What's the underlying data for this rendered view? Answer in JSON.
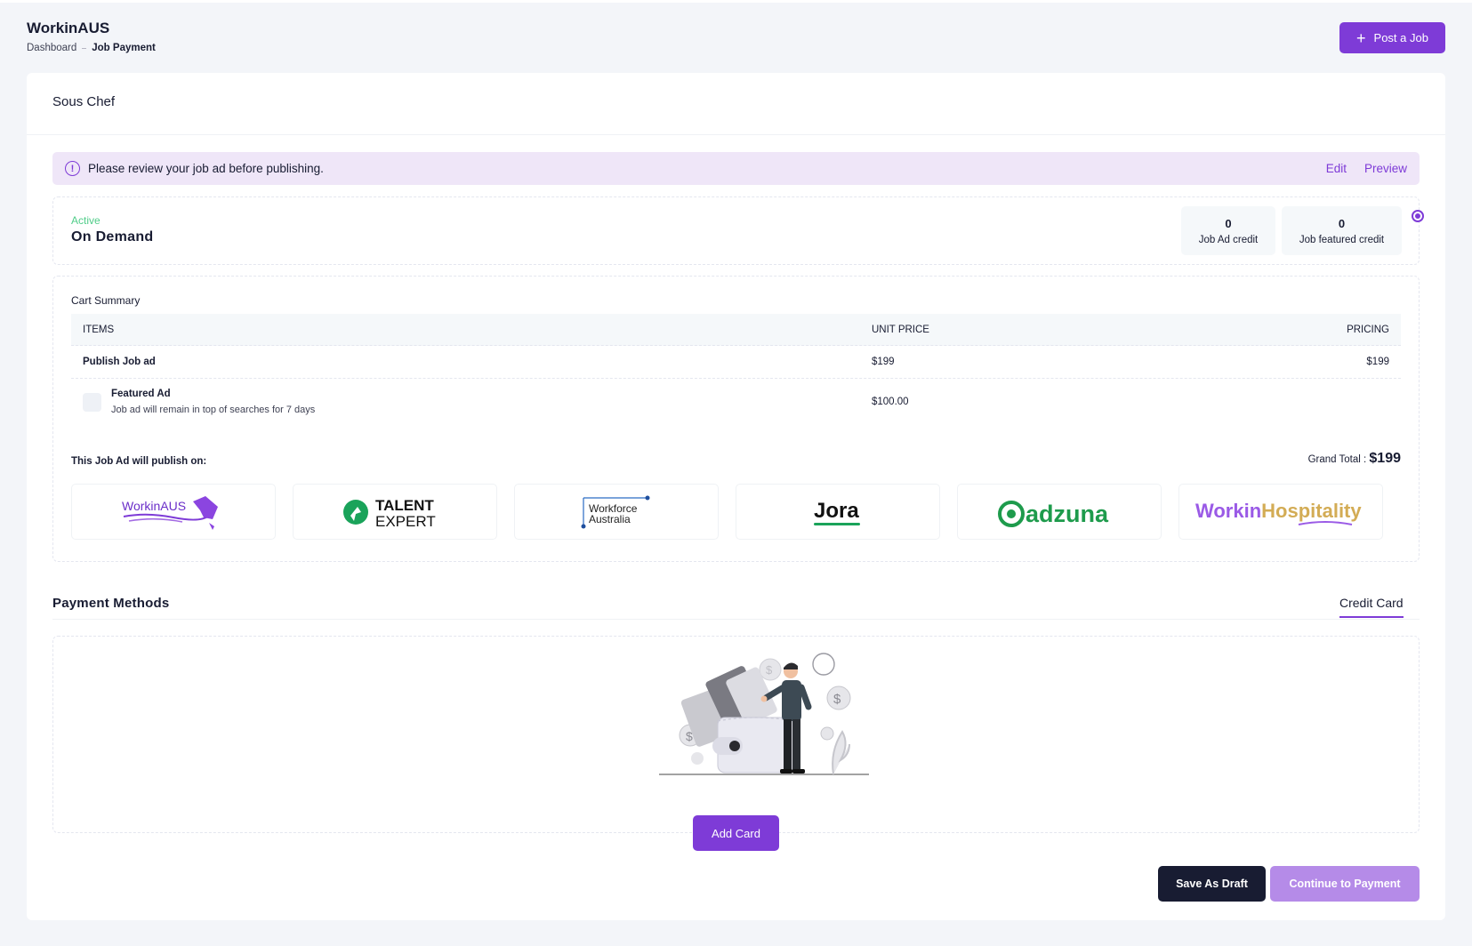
{
  "app": {
    "title": "WorkinAUS"
  },
  "breadcrumb": {
    "root": "Dashboard",
    "current": "Job Payment"
  },
  "header": {
    "post_job_label": "Post a Job"
  },
  "job": {
    "title": "Sous Chef"
  },
  "notice": {
    "text": "Please review your job ad before publishing.",
    "edit_label": "Edit",
    "preview_label": "Preview"
  },
  "plan": {
    "status": "Active",
    "name": "On Demand",
    "credits": [
      {
        "value": "0",
        "label": "Job Ad credit"
      },
      {
        "value": "0",
        "label": "Job featured credit"
      }
    ]
  },
  "cart": {
    "title": "Cart Summary",
    "headers": {
      "items": "ITEMS",
      "unit_price": "UNIT PRICE",
      "pricing": "PRICING"
    },
    "rows": [
      {
        "item": "Publish Job ad",
        "unit_price": "$199",
        "pricing": "$199"
      }
    ],
    "featured": {
      "title": "Featured Ad",
      "description": "Job ad will remain in top of searches for 7 days",
      "unit_price": "$100.00",
      "checked": false
    },
    "publish_on_label": "This Job Ad will publish on:",
    "grand_total_label": "Grand Total :",
    "grand_total_value": "$199"
  },
  "publishers": [
    {
      "name": "WorkinAUS",
      "icon": "workinaus-logo"
    },
    {
      "name": "TALENT EXPERT",
      "line1": "TALENT",
      "line2": "EXPERT",
      "icon": "talent-expert-logo"
    },
    {
      "name": "Workforce Australia",
      "line1": "Workforce",
      "line2": "Australia",
      "icon": "workforce-australia-logo"
    },
    {
      "name": "Jora",
      "icon": "jora-logo"
    },
    {
      "name": "adzuna",
      "icon": "adzuna-logo"
    },
    {
      "name": "WorkinHospitality",
      "part1": "Workin",
      "part2": "Hospitality",
      "icon": "workinhospitality-logo"
    }
  ],
  "payment": {
    "title": "Payment Methods",
    "tab": "Credit Card",
    "add_card_label": "Add Card"
  },
  "footer": {
    "save_draft_label": "Save As Draft",
    "continue_label": "Continue to Payment"
  },
  "colors": {
    "accent": "#7e3bd7",
    "accent_light": "#b58be8",
    "dark": "#181c32",
    "success": "#50cd89",
    "notice_bg": "#efe6f8"
  }
}
